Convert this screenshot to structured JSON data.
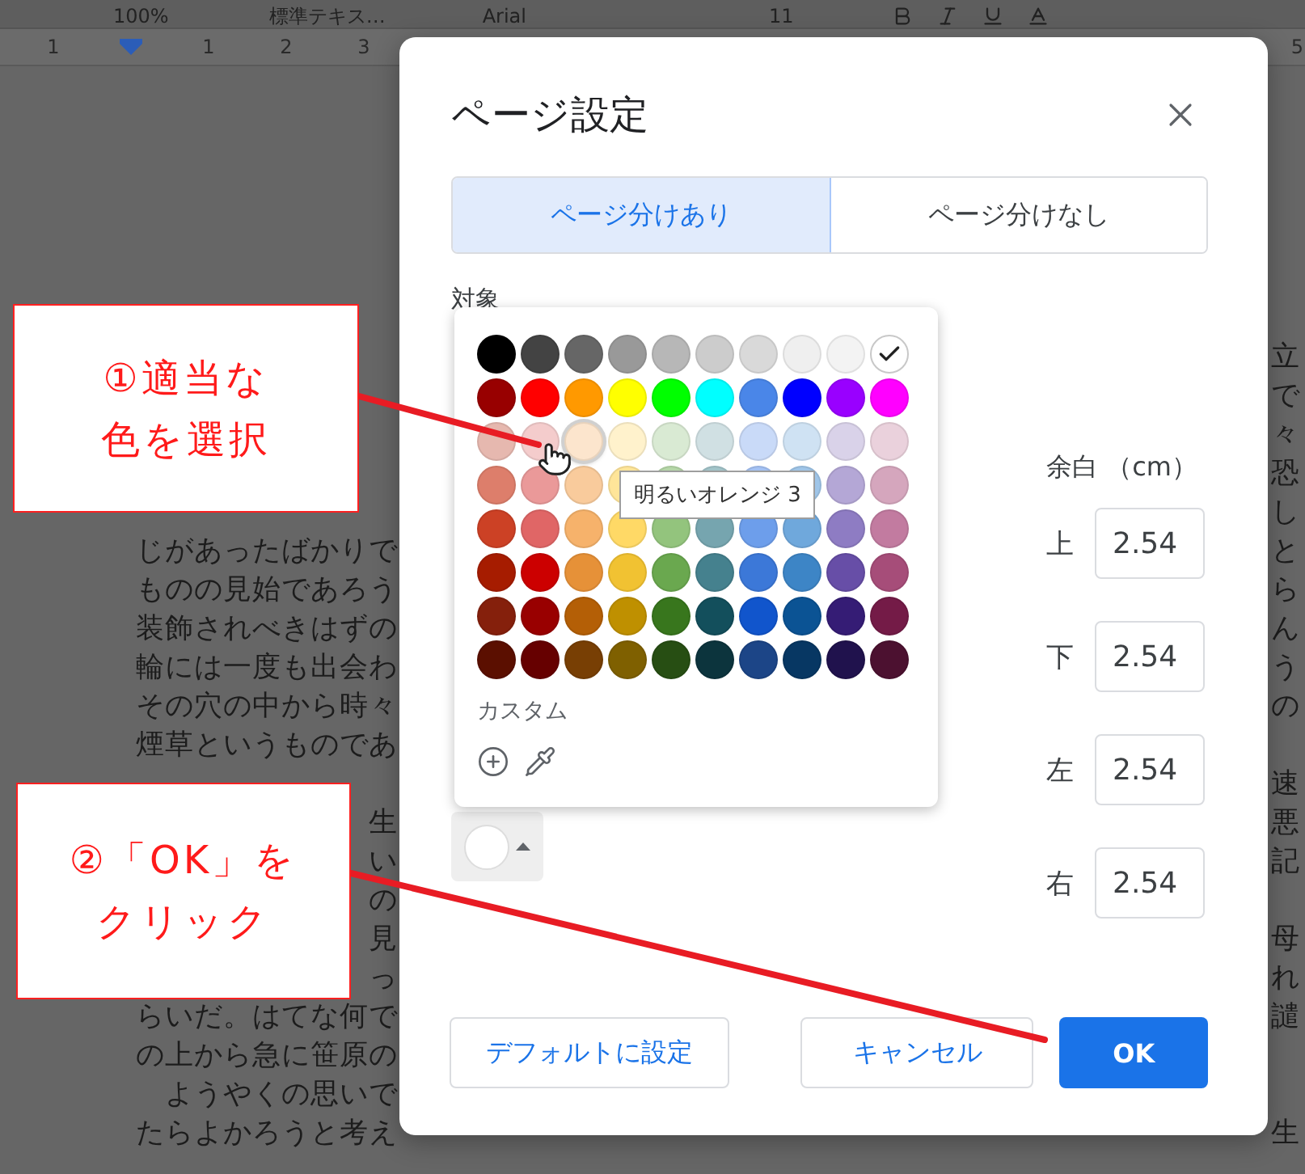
{
  "toolbar": {
    "zoom": "100%",
    "style": "標準テキス…",
    "font": "Arial",
    "size": "11"
  },
  "ruler": {
    "labels": [
      "1",
      "1",
      "2",
      "3",
      "5"
    ]
  },
  "document": {
    "lines": [
      {
        "right": "立"
      },
      {
        "right": "で"
      },
      {
        "right": "々"
      },
      {
        "right": "恐"
      },
      {
        "right": "し"
      },
      {
        "left": "じがあったばかりで",
        "right": "と"
      },
      {
        "left": "ものの見始であろう",
        "right": "ら"
      },
      {
        "left": "装飾されべきはずの",
        "right": "ん"
      },
      {
        "left": "輪には一度も出会わ",
        "right": "う"
      },
      {
        "left": "その穴の中から時々",
        "right": "の"
      },
      {
        "left": "煙草というものであ"
      },
      {
        "right": "速"
      },
      {
        "left": "生",
        "right": "悪"
      },
      {
        "left": "い",
        "right": "記"
      },
      {
        "left": "の"
      },
      {
        "left": "見",
        "right": "母"
      },
      {
        "left": "っ",
        "right": "れ"
      },
      {
        "left": "らいだ。はてな何で",
        "right": "譴"
      },
      {
        "left": "の上から急に笹原の"
      },
      {
        "left": "ようやくの思いで"
      },
      {
        "left": "たらよかろうと考え",
        "right": "生"
      }
    ]
  },
  "dialog": {
    "title": "ページ設定",
    "tabs": [
      {
        "label": "ページ分けあり",
        "selected": true
      },
      {
        "label": "ページ分けなし",
        "selected": false
      }
    ],
    "target_label": "対象",
    "palette": {
      "rows": [
        [
          {
            "color": "#000000",
            "selected": false,
            "hovered": false
          },
          {
            "color": "#434343",
            "selected": false,
            "hovered": false
          },
          {
            "color": "#666666",
            "selected": false,
            "hovered": false
          },
          {
            "color": "#999999",
            "selected": false,
            "hovered": false
          },
          {
            "color": "#b7b7b7",
            "selected": false,
            "hovered": false
          },
          {
            "color": "#cccccc",
            "selected": false,
            "hovered": false
          },
          {
            "color": "#d9d9d9",
            "selected": false,
            "hovered": false
          },
          {
            "color": "#efefef",
            "selected": false,
            "hovered": false
          },
          {
            "color": "#f3f3f3",
            "selected": false,
            "hovered": false
          },
          {
            "color": "#ffffff",
            "selected": true,
            "hovered": false
          }
        ],
        [
          {
            "color": "#980000",
            "selected": false,
            "hovered": false
          },
          {
            "color": "#ff0000",
            "selected": false,
            "hovered": false
          },
          {
            "color": "#ff9900",
            "selected": false,
            "hovered": false
          },
          {
            "color": "#ffff00",
            "selected": false,
            "hovered": false
          },
          {
            "color": "#00ff00",
            "selected": false,
            "hovered": false
          },
          {
            "color": "#00ffff",
            "selected": false,
            "hovered": false
          },
          {
            "color": "#4a86e8",
            "selected": false,
            "hovered": false
          },
          {
            "color": "#0000ff",
            "selected": false,
            "hovered": false
          },
          {
            "color": "#9900ff",
            "selected": false,
            "hovered": false
          },
          {
            "color": "#ff00ff",
            "selected": false,
            "hovered": false
          }
        ],
        [
          {
            "color": "#e6b8af",
            "selected": false,
            "hovered": false
          },
          {
            "color": "#f4cccc",
            "selected": false,
            "hovered": false
          },
          {
            "color": "#fce5cd",
            "selected": false,
            "hovered": true
          },
          {
            "color": "#fff2cc",
            "selected": false,
            "hovered": false
          },
          {
            "color": "#d9ead3",
            "selected": false,
            "hovered": false
          },
          {
            "color": "#d0e0e3",
            "selected": false,
            "hovered": false
          },
          {
            "color": "#c9daf8",
            "selected": false,
            "hovered": false
          },
          {
            "color": "#cfe2f3",
            "selected": false,
            "hovered": false
          },
          {
            "color": "#d9d2e9",
            "selected": false,
            "hovered": false
          },
          {
            "color": "#ead1dc",
            "selected": false,
            "hovered": false
          }
        ],
        [
          {
            "color": "#dd7e6b",
            "selected": false,
            "hovered": false
          },
          {
            "color": "#ea9999",
            "selected": false,
            "hovered": false
          },
          {
            "color": "#f9cb9c",
            "selected": false,
            "hovered": false
          },
          {
            "color": "#ffe599",
            "selected": false,
            "hovered": false
          },
          {
            "color": "#b6d7a8",
            "selected": false,
            "hovered": false
          },
          {
            "color": "#a2c4c9",
            "selected": false,
            "hovered": false
          },
          {
            "color": "#a4c2f4",
            "selected": false,
            "hovered": false
          },
          {
            "color": "#9fc5e8",
            "selected": false,
            "hovered": false
          },
          {
            "color": "#b4a7d6",
            "selected": false,
            "hovered": false
          },
          {
            "color": "#d5a6bd",
            "selected": false,
            "hovered": false
          }
        ],
        [
          {
            "color": "#cc4125",
            "selected": false,
            "hovered": false
          },
          {
            "color": "#e06666",
            "selected": false,
            "hovered": false
          },
          {
            "color": "#f6b26b",
            "selected": false,
            "hovered": false
          },
          {
            "color": "#ffd966",
            "selected": false,
            "hovered": false
          },
          {
            "color": "#93c47d",
            "selected": false,
            "hovered": false
          },
          {
            "color": "#76a5af",
            "selected": false,
            "hovered": false
          },
          {
            "color": "#6d9eeb",
            "selected": false,
            "hovered": false
          },
          {
            "color": "#6fa8dc",
            "selected": false,
            "hovered": false
          },
          {
            "color": "#8e7cc3",
            "selected": false,
            "hovered": false
          },
          {
            "color": "#c27ba0",
            "selected": false,
            "hovered": false
          }
        ],
        [
          {
            "color": "#a61c00",
            "selected": false,
            "hovered": false
          },
          {
            "color": "#cc0000",
            "selected": false,
            "hovered": false
          },
          {
            "color": "#e69138",
            "selected": false,
            "hovered": false
          },
          {
            "color": "#f1c232",
            "selected": false,
            "hovered": false
          },
          {
            "color": "#6aa84f",
            "selected": false,
            "hovered": false
          },
          {
            "color": "#45818e",
            "selected": false,
            "hovered": false
          },
          {
            "color": "#3c78d8",
            "selected": false,
            "hovered": false
          },
          {
            "color": "#3d85c6",
            "selected": false,
            "hovered": false
          },
          {
            "color": "#674ea7",
            "selected": false,
            "hovered": false
          },
          {
            "color": "#a64d79",
            "selected": false,
            "hovered": false
          }
        ],
        [
          {
            "color": "#85200c",
            "selected": false,
            "hovered": false
          },
          {
            "color": "#990000",
            "selected": false,
            "hovered": false
          },
          {
            "color": "#b45f06",
            "selected": false,
            "hovered": false
          },
          {
            "color": "#bf9000",
            "selected": false,
            "hovered": false
          },
          {
            "color": "#38761d",
            "selected": false,
            "hovered": false
          },
          {
            "color": "#134f5c",
            "selected": false,
            "hovered": false
          },
          {
            "color": "#1155cc",
            "selected": false,
            "hovered": false
          },
          {
            "color": "#0b5394",
            "selected": false,
            "hovered": false
          },
          {
            "color": "#351c75",
            "selected": false,
            "hovered": false
          },
          {
            "color": "#741b47",
            "selected": false,
            "hovered": false
          }
        ],
        [
          {
            "color": "#5b0f00",
            "selected": false,
            "hovered": false
          },
          {
            "color": "#660000",
            "selected": false,
            "hovered": false
          },
          {
            "color": "#783f04",
            "selected": false,
            "hovered": false
          },
          {
            "color": "#7f6000",
            "selected": false,
            "hovered": false
          },
          {
            "color": "#274e13",
            "selected": false,
            "hovered": false
          },
          {
            "color": "#0c343d",
            "selected": false,
            "hovered": false
          },
          {
            "color": "#1c4587",
            "selected": false,
            "hovered": false
          },
          {
            "color": "#073763",
            "selected": false,
            "hovered": false
          },
          {
            "color": "#20124d",
            "selected": false,
            "hovered": false
          },
          {
            "color": "#4c1130",
            "selected": false,
            "hovered": false
          }
        ]
      ],
      "custom_label": "カスタム",
      "tooltip": "明るいオレンジ 3"
    },
    "margins": {
      "heading": "余白 （cm）",
      "fields": [
        {
          "label": "上",
          "value": "2.54"
        },
        {
          "label": "下",
          "value": "2.54"
        },
        {
          "label": "左",
          "value": "2.54"
        },
        {
          "label": "右",
          "value": "2.54"
        }
      ]
    },
    "buttons": [
      {
        "label": "デフォルトに設定",
        "kind": "secondary"
      },
      {
        "label": "キャンセル",
        "kind": "secondary"
      },
      {
        "label": "OK",
        "kind": "primary"
      }
    ]
  },
  "annotations": [
    {
      "lines": [
        "①適当な",
        "色を選択"
      ]
    },
    {
      "lines": [
        "②「OK」を",
        "クリック"
      ]
    }
  ]
}
